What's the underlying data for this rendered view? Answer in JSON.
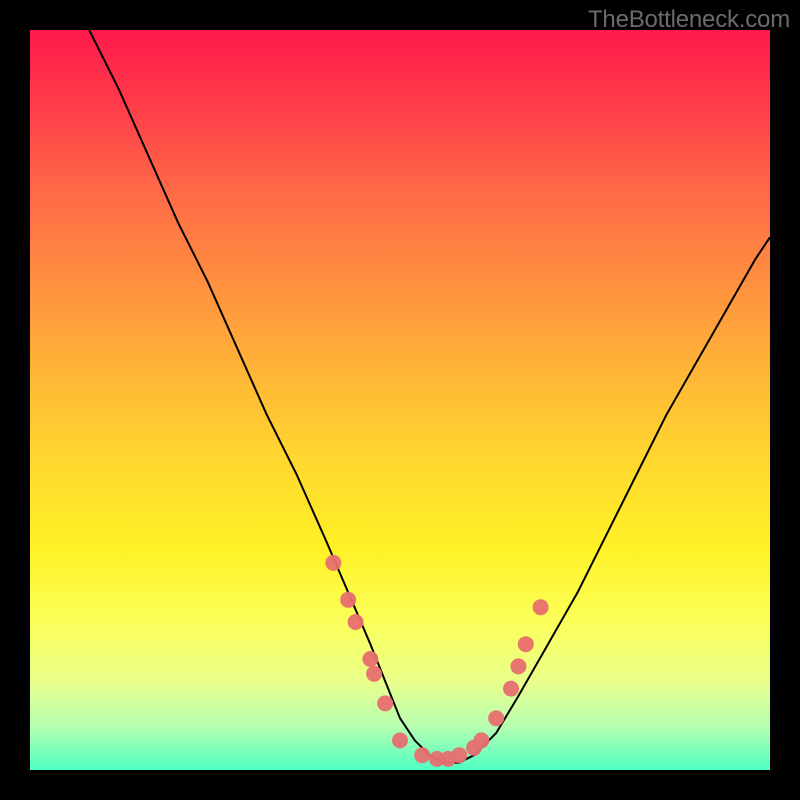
{
  "watermark": "TheBottleneck.com",
  "colors": {
    "dot": "#e76f6f",
    "curve": "#000000"
  },
  "chart_data": {
    "type": "line",
    "title": "",
    "xlabel": "",
    "ylabel": "",
    "xlim": [
      0,
      100
    ],
    "ylim": [
      0,
      100
    ],
    "grid": false,
    "series": [
      {
        "name": "curve",
        "x": [
          8,
          12,
          16,
          20,
          24,
          28,
          32,
          36,
          40,
          43,
          46,
          48,
          50,
          52,
          54,
          56,
          58,
          60,
          63,
          66,
          70,
          74,
          78,
          82,
          86,
          90,
          94,
          98,
          100
        ],
        "y": [
          100,
          92,
          83,
          74,
          66,
          57,
          48,
          40,
          31,
          24,
          17,
          12,
          7,
          4,
          2,
          1,
          1,
          2,
          5,
          10,
          17,
          24,
          32,
          40,
          48,
          55,
          62,
          69,
          72
        ]
      }
    ],
    "scatter": {
      "name": "dots",
      "x": [
        41,
        43,
        44,
        46,
        46.5,
        48,
        50,
        53,
        55,
        56.5,
        58,
        60,
        61,
        63,
        65,
        66,
        67,
        69
      ],
      "y": [
        28,
        23,
        20,
        15,
        13,
        9,
        4,
        2,
        1.5,
        1.5,
        2,
        3,
        4,
        7,
        11,
        14,
        17,
        22
      ]
    }
  }
}
